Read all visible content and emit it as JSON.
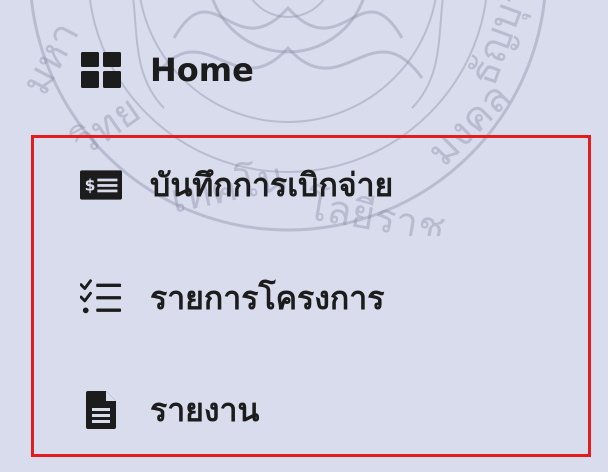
{
  "sidebar": {
    "items": [
      {
        "label": "Home",
        "icon": "grid-icon"
      },
      {
        "label": "บันทึกการเบิกจ่าย",
        "icon": "payment-card-icon"
      },
      {
        "label": "รายการโครงการ",
        "icon": "checklist-icon"
      },
      {
        "label": "รายงาน",
        "icon": "document-icon"
      }
    ]
  },
  "colors": {
    "background": "#d9dcec",
    "text": "#1c1c1c",
    "highlight": "#e11d1d",
    "watermark": "#6a6f8a"
  }
}
